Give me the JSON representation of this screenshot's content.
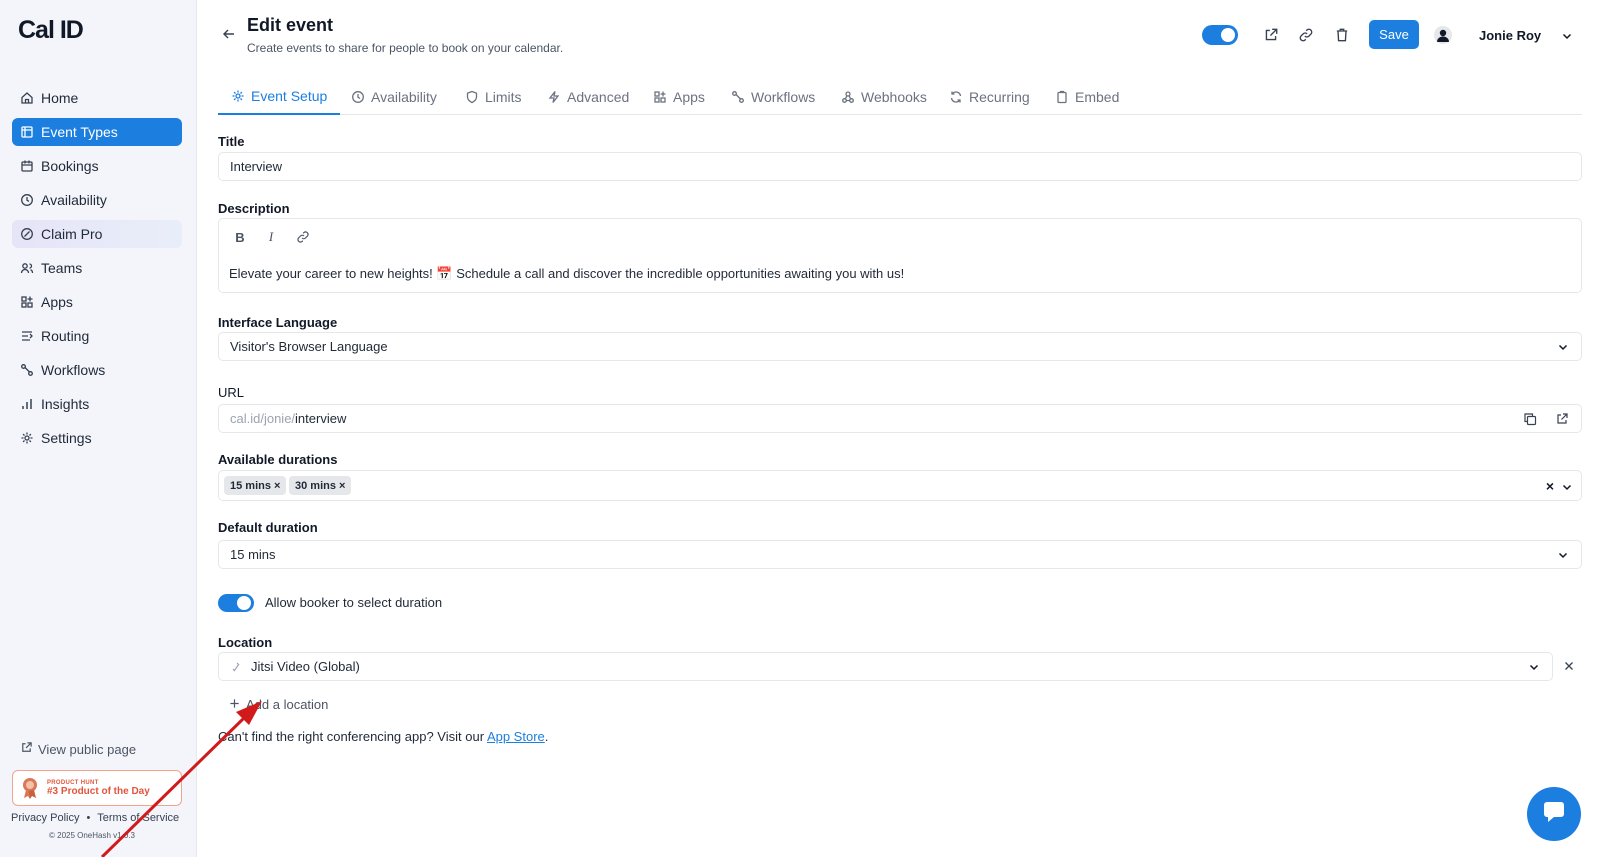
{
  "app": {
    "logo": "Cal ID"
  },
  "sidebar": {
    "items": [
      {
        "label": "Home",
        "icon": "home-icon"
      },
      {
        "label": "Event Types",
        "icon": "event-types-icon",
        "active": true
      },
      {
        "label": "Bookings",
        "icon": "calendar-icon"
      },
      {
        "label": "Availability",
        "icon": "clock-icon"
      },
      {
        "label": "Claim Pro",
        "icon": "badge-icon"
      },
      {
        "label": "Teams",
        "icon": "users-icon"
      },
      {
        "label": "Apps",
        "icon": "grid-plus-icon"
      },
      {
        "label": "Routing",
        "icon": "routing-icon"
      },
      {
        "label": "Workflows",
        "icon": "workflow-icon"
      },
      {
        "label": "Insights",
        "icon": "bar-chart-icon"
      },
      {
        "label": "Settings",
        "icon": "gear-icon"
      }
    ],
    "view_public": "View public page",
    "badge": {
      "small": "PRODUCT HUNT",
      "big": "#3 Product of the Day"
    },
    "footer": {
      "privacy": "Privacy Policy",
      "sep": "•",
      "terms": "Terms of Service"
    },
    "copyright": "© 2025 OneHash v1.0.3"
  },
  "header": {
    "title": "Edit event",
    "subtitle": "Create events to share for people to book on your calendar.",
    "save_label": "Save",
    "user_name": "Jonie Roy",
    "toggle_on": true
  },
  "tabs": [
    {
      "label": "Event Setup",
      "icon": "gear-icon",
      "active": true
    },
    {
      "label": "Availability",
      "icon": "clock-icon"
    },
    {
      "label": "Limits",
      "icon": "shield-icon"
    },
    {
      "label": "Advanced",
      "icon": "zap-icon"
    },
    {
      "label": "Apps",
      "icon": "grid-plus-icon"
    },
    {
      "label": "Workflows",
      "icon": "workflow-icon"
    },
    {
      "label": "Webhooks",
      "icon": "webhook-icon"
    },
    {
      "label": "Recurring",
      "icon": "repeat-icon"
    },
    {
      "label": "Embed",
      "icon": "clipboard-icon"
    }
  ],
  "form": {
    "title_label": "Title",
    "title_value": "Interview",
    "description_label": "Description",
    "description_value": "Elevate your career to new heights! 📅 Schedule a call and discover the incredible opportunities awaiting you with us!",
    "language_label": "Interface Language",
    "language_value": "Visitor's Browser Language",
    "url_label": "URL",
    "url_prefix": "cal.id/jonie/",
    "url_slug": "interview",
    "durations_label": "Available durations",
    "durations": [
      "15 mins",
      "30 mins"
    ],
    "default_duration_label": "Default duration",
    "default_duration_value": "15 mins",
    "allow_select_label": "Allow booker to select duration",
    "allow_select_on": true,
    "location_label": "Location",
    "location_value": "Jitsi Video (Global)",
    "add_location": "Add a location",
    "help_text": "Can't find the right conferencing app? Visit our",
    "help_link": "App Store",
    "help_end": "."
  },
  "colors": {
    "accent": "#1c7fe0",
    "arrow": "#d11a1a"
  }
}
